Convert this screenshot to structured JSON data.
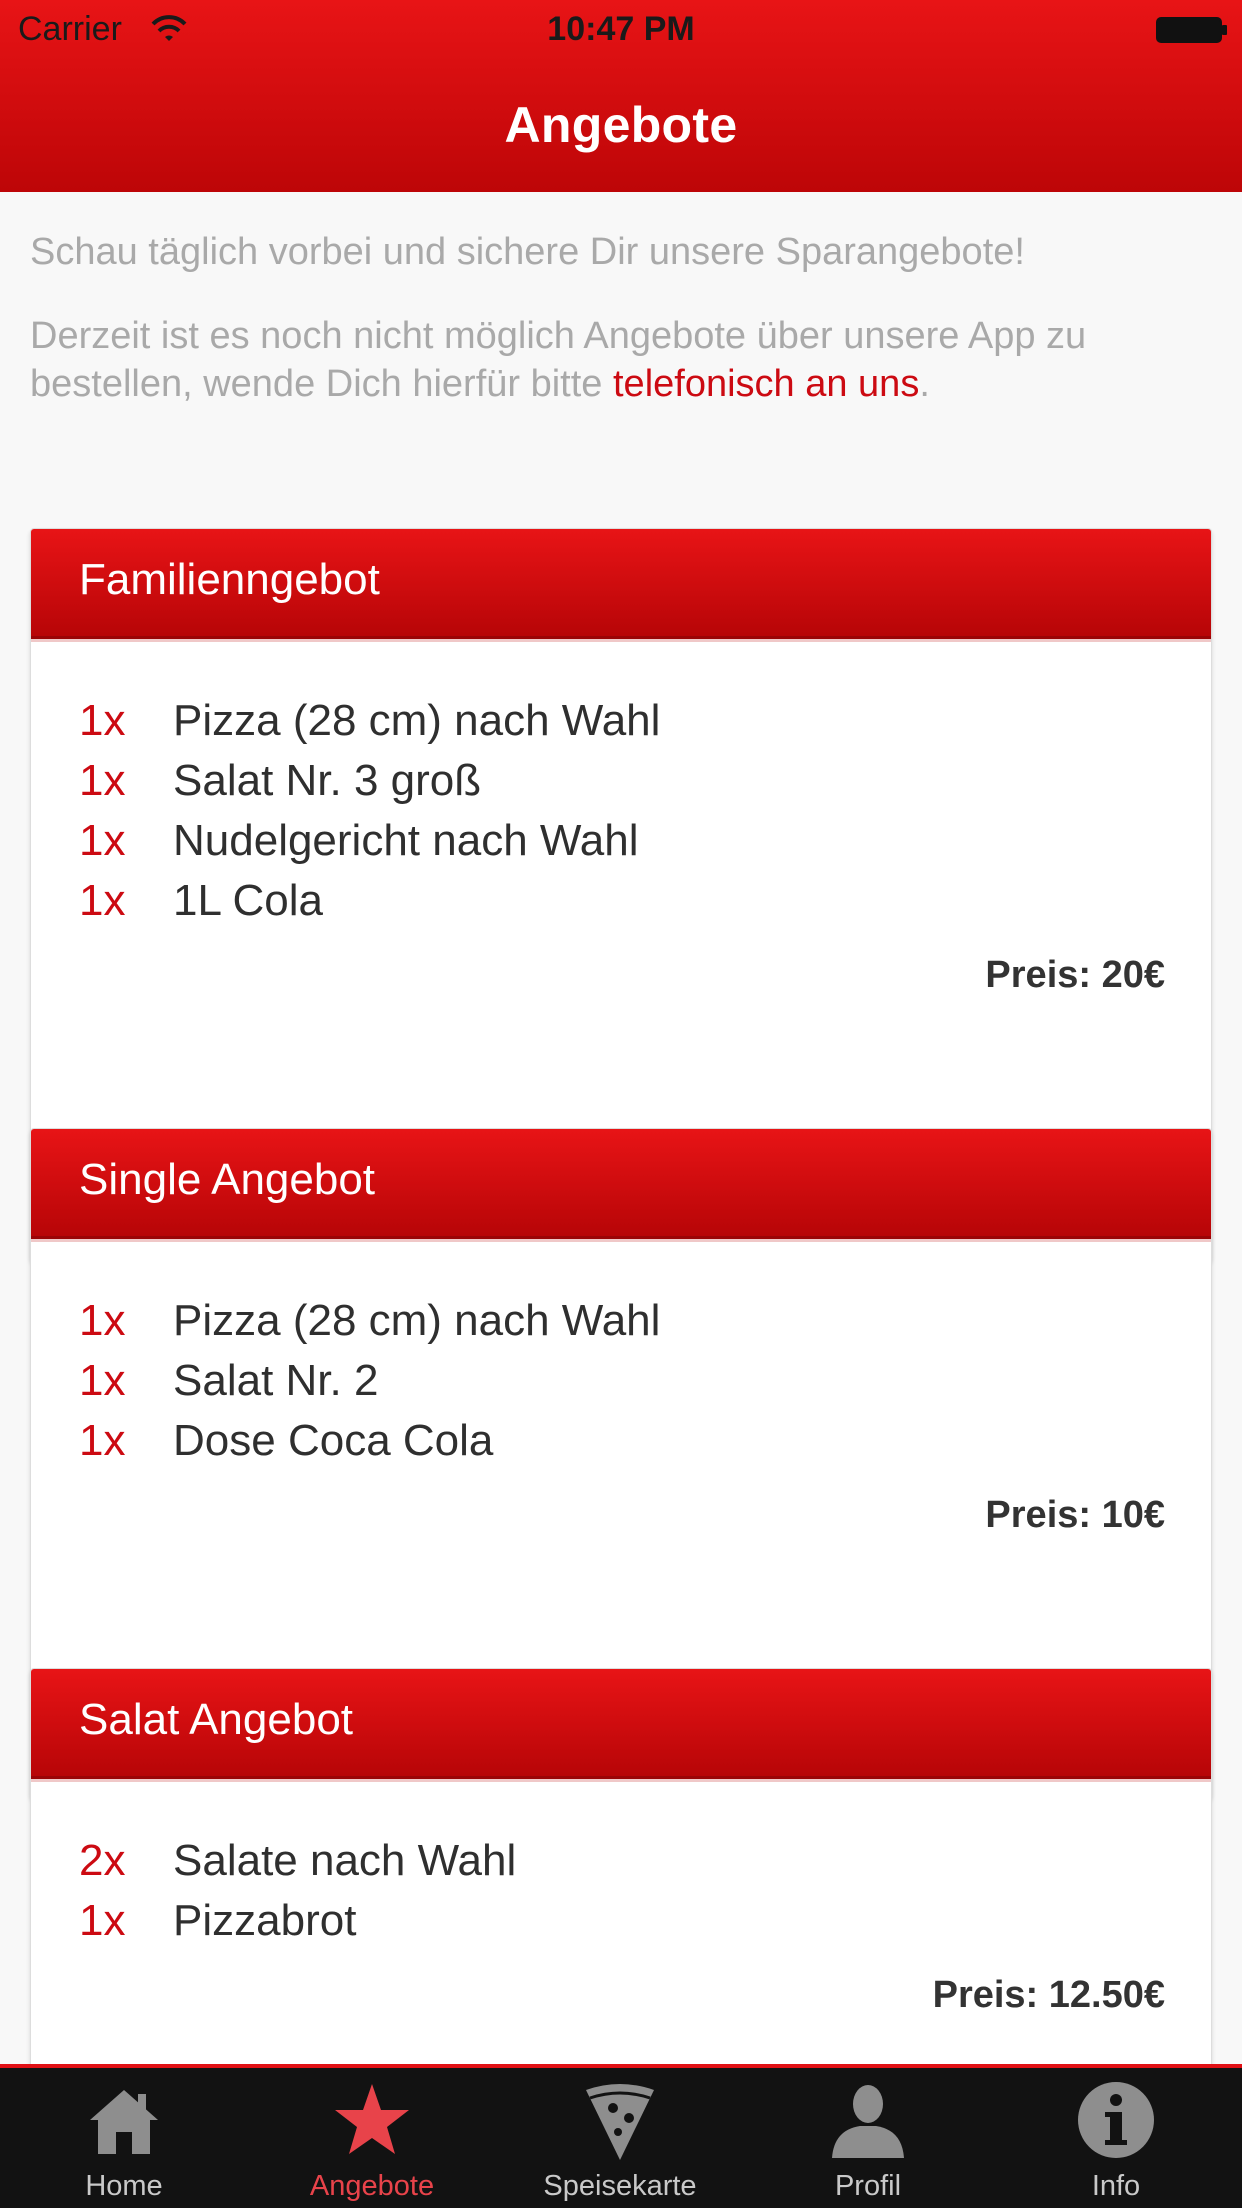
{
  "status_bar": {
    "carrier": "Carrier",
    "time": "10:47 PM"
  },
  "nav": {
    "title": "Angebote"
  },
  "intro": {
    "line1": "Schau täglich vorbei und sichere Dir unsere Sparangebote!",
    "line2_part1": "Derzeit ist es noch nicht möglich Angebote über unsere App zu bestellen, wende Dich hierfür bitte ",
    "link_text": "telefonisch an uns",
    "line2_end": "."
  },
  "offers": [
    {
      "title": "Familienngebot",
      "items": [
        {
          "qty": "1x",
          "name": "Pizza (28 cm) nach Wahl"
        },
        {
          "qty": "1x",
          "name": "Salat Nr. 3 groß"
        },
        {
          "qty": "1x",
          "name": "Nudelgericht nach Wahl"
        },
        {
          "qty": "1x",
          "name": "1L Cola"
        }
      ],
      "price": "Preis: 20€"
    },
    {
      "title": "Single Angebot",
      "items": [
        {
          "qty": "1x",
          "name": "Pizza (28 cm) nach Wahl"
        },
        {
          "qty": "1x",
          "name": "Salat Nr. 2"
        },
        {
          "qty": "1x",
          "name": "Dose Coca Cola"
        }
      ],
      "price": "Preis: 10€"
    },
    {
      "title": "Salat Angebot",
      "items": [
        {
          "qty": "2x",
          "name": "Salate nach Wahl"
        },
        {
          "qty": "1x",
          "name": "Pizzabrot"
        }
      ],
      "price": "Preis: 12.50€"
    }
  ],
  "tabs": [
    {
      "label": "Home",
      "icon": "house-icon"
    },
    {
      "label": "Angebote",
      "icon": "star-icon",
      "active": true
    },
    {
      "label": "Speisekarte",
      "icon": "pizza-slice-icon"
    },
    {
      "label": "Profil",
      "icon": "person-icon"
    },
    {
      "label": "Info",
      "icon": "info-icon"
    }
  ],
  "colors": {
    "brand_red": "#e01015",
    "text_red": "#cc0a12",
    "tab_active": "#e8434a",
    "tabbar_bg": "#121212"
  }
}
